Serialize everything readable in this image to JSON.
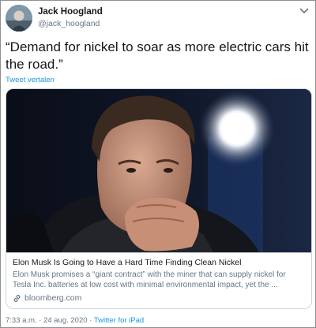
{
  "author": {
    "name": "Jack Hoogland",
    "handle": "@jack_hoogland"
  },
  "tweet": {
    "text": "“Demand for nickel to soar as more electric cars hit the road.”",
    "translate_label": "Tweet vertalen"
  },
  "card": {
    "title": "Elon Musk Is Going to Have a Hard Time Finding Clean Nickel",
    "description": "Elon Musk promises a “giant contract” with the miner that can supply nickel for Tesla Inc. batteries at low cost with minimal environmental impact, yet the ...",
    "domain": "bloomberg.com"
  },
  "meta": {
    "time": "7:33 a.m.",
    "separator": "·",
    "date": "24 aug. 2020",
    "source": "Twitter for iPad"
  },
  "icons": {
    "menu": "chevron-down-icon",
    "link": "link-icon"
  },
  "colors": {
    "accent": "#1b95e0",
    "text_primary": "#14171a",
    "text_secondary": "#657786",
    "border": "#ccd6dd"
  }
}
